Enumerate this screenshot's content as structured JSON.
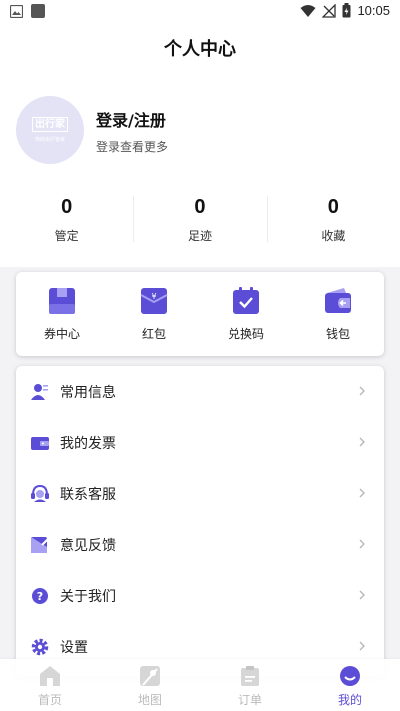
{
  "status_bar": {
    "time": "10:05"
  },
  "page_title": "个人中心",
  "profile": {
    "avatar_logo": "出行家",
    "avatar_sub": "你的出行管家",
    "login_title": "登录/注册",
    "login_sub": "登录查看更多"
  },
  "stats": [
    {
      "value": "0",
      "label": "管定"
    },
    {
      "value": "0",
      "label": "足迹"
    },
    {
      "value": "0",
      "label": "收藏"
    }
  ],
  "quick_actions": [
    {
      "label": "券中心",
      "icon": "coupon-icon"
    },
    {
      "label": "红包",
      "icon": "red-envelope-icon"
    },
    {
      "label": "兑换码",
      "icon": "redeem-code-icon"
    },
    {
      "label": "钱包",
      "icon": "wallet-icon"
    }
  ],
  "menu": [
    {
      "label": "常用信息",
      "icon": "contact-info-icon"
    },
    {
      "label": "我的发票",
      "icon": "invoice-icon"
    },
    {
      "label": "联系客服",
      "icon": "customer-service-icon"
    },
    {
      "label": "意见反馈",
      "icon": "feedback-icon"
    },
    {
      "label": "关于我们",
      "icon": "about-icon"
    },
    {
      "label": "设置",
      "icon": "settings-icon"
    }
  ],
  "tabs": [
    {
      "label": "首页",
      "icon": "home-icon",
      "active": false
    },
    {
      "label": "地图",
      "icon": "map-icon",
      "active": false
    },
    {
      "label": "订单",
      "icon": "order-icon",
      "active": false
    },
    {
      "label": "我的",
      "icon": "profile-icon",
      "active": true
    }
  ],
  "colors": {
    "accent": "#5b4dd6",
    "inactive_tab": "#d0d0d0"
  }
}
